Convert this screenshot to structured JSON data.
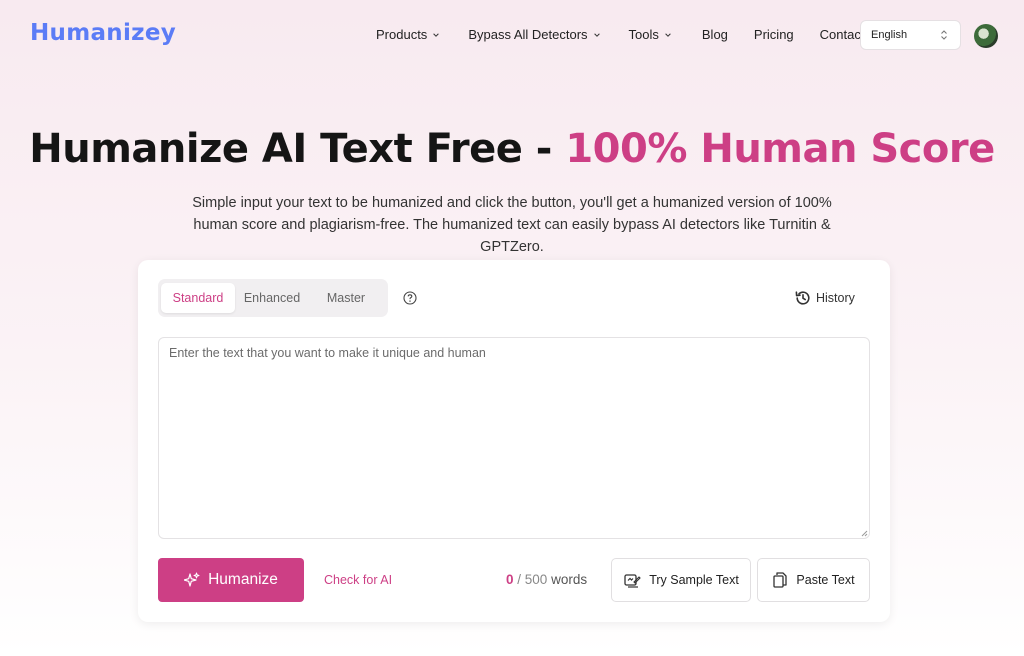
{
  "brand": {
    "logo": "Humanizey",
    "accent_color": "#cd3f85",
    "logo_color": "#5b7cf6"
  },
  "nav": {
    "items": [
      {
        "label": "Products",
        "has_dropdown": true
      },
      {
        "label": "Bypass All Detectors",
        "has_dropdown": true
      },
      {
        "label": "Tools",
        "has_dropdown": true
      },
      {
        "label": "Blog",
        "has_dropdown": false
      },
      {
        "label": "Pricing",
        "has_dropdown": false
      },
      {
        "label": "Contact",
        "has_dropdown": false
      }
    ],
    "language": "English"
  },
  "hero": {
    "title_main": "Humanize AI Text Free - ",
    "title_accent": "100% Human Score",
    "subtitle": "Simple input your text to be humanized and click the button, you'll get a humanized version of 100% human score and plagiarism-free. The humanized text can easily bypass AI detectors like Turnitin & GPTZero."
  },
  "editor": {
    "modes": [
      "Standard",
      "Enhanced",
      "Master"
    ],
    "active_mode": "Standard",
    "history_label": "History",
    "placeholder": "Enter the text that you want to make it unique and human",
    "value": ""
  },
  "actions": {
    "humanize_label": "Humanize",
    "check_ai_label": "Check for AI",
    "word_count": "0",
    "word_separator": " / ",
    "word_limit": "500",
    "word_unit": " words",
    "sample_label": "Try Sample Text",
    "paste_label": "Paste Text"
  }
}
